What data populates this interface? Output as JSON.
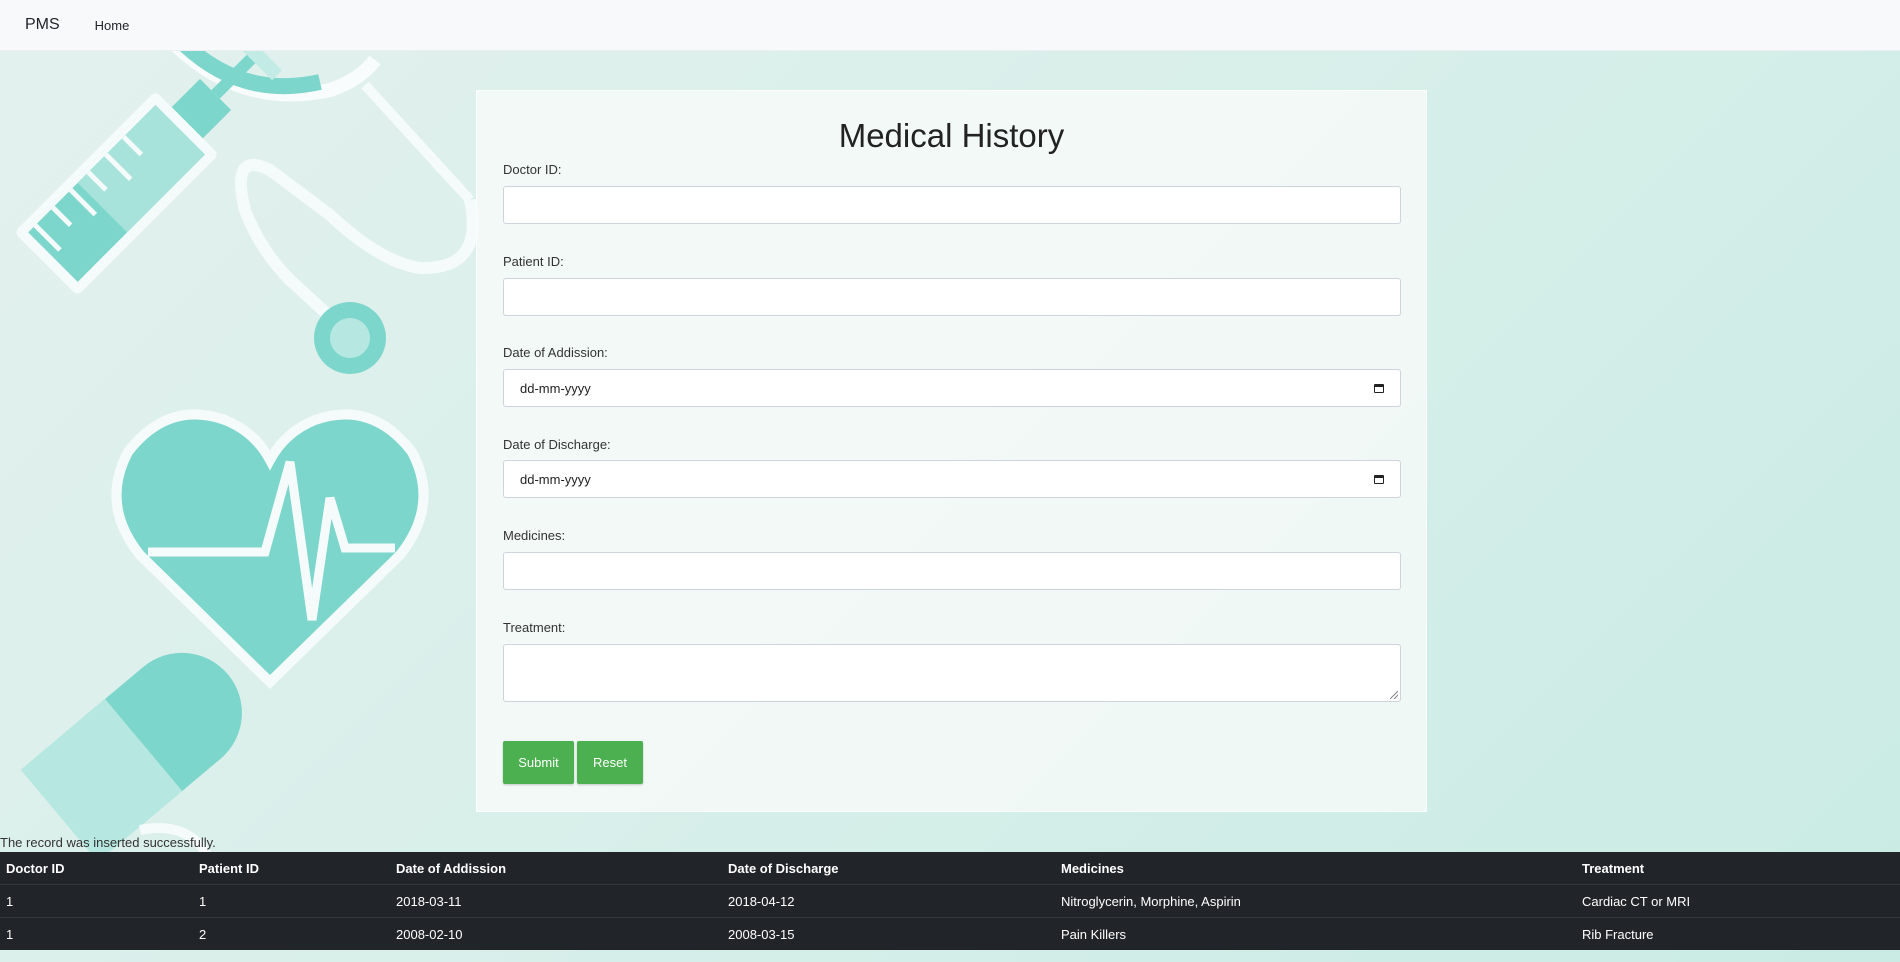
{
  "navbar": {
    "brand": "PMS",
    "home": "Home"
  },
  "form": {
    "title": "Medical History",
    "doctor_id_label": "Doctor ID:",
    "patient_id_label": "Patient ID:",
    "admission_label": "Date of Addission:",
    "admission_placeholder": "dd-mm-yyyy",
    "discharge_label": "Date of Discharge:",
    "discharge_placeholder": "dd-mm-yyyy",
    "medicines_label": "Medicines:",
    "treatment_label": "Treatment:",
    "submit_label": "Submit",
    "reset_label": "Reset"
  },
  "status_message": "The record was inserted successfully.",
  "table": {
    "headers": [
      "Doctor ID",
      "Patient ID",
      "Date of Addission",
      "Date of Discharge",
      "Medicines",
      "Treatment"
    ],
    "rows": [
      [
        "1",
        "1",
        "2018-03-11",
        "2018-04-12",
        "Nitroglycerin, Morphine, Aspirin",
        "Cardiac CT or MRI"
      ],
      [
        "1",
        "2",
        "2008-02-10",
        "2008-03-15",
        "Pain Killers",
        "Rib Fracture"
      ]
    ]
  },
  "colors": {
    "accent": "#4caf50",
    "illustration": "#7dd6cb",
    "table_bg": "#212529"
  }
}
